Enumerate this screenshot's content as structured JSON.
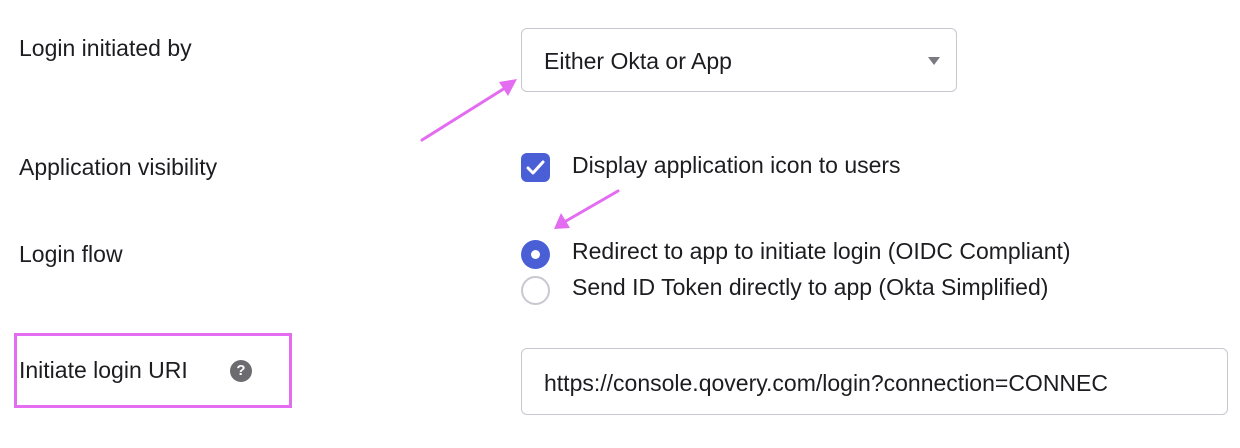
{
  "fields": {
    "login_initiated_by": {
      "label": "Login initiated by",
      "selected_value": "Either Okta or App"
    },
    "application_visibility": {
      "label": "Application visibility",
      "checkbox_label": "Display application icon to users",
      "checked": true
    },
    "login_flow": {
      "label": "Login flow",
      "options": [
        {
          "label": "Redirect to app to initiate login (OIDC Compliant)",
          "selected": true
        },
        {
          "label": "Send ID Token directly to app (Okta Simplified)",
          "selected": false
        }
      ]
    },
    "initiate_login_uri": {
      "label": "Initiate login URI",
      "help_symbol": "?",
      "value": "https://console.qovery.com/login?connection=CONNEC"
    }
  },
  "annotations": {
    "arrow_color": "#e36cf0",
    "highlight_color": "#e36cf0"
  },
  "colors": {
    "accent": "#4a5fd6",
    "border": "#c8c8d0",
    "text": "#1d1d21"
  }
}
